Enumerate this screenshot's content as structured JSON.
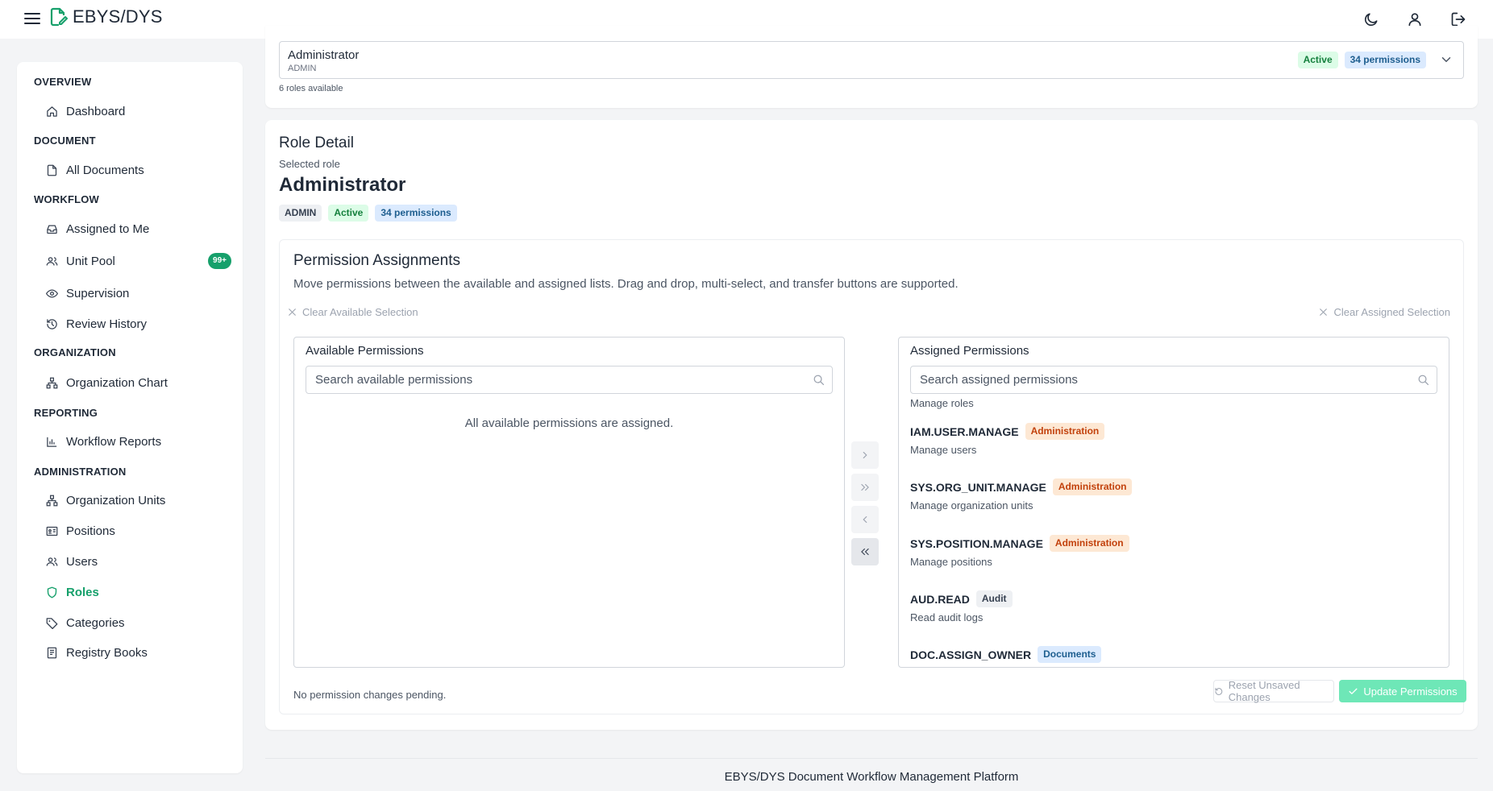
{
  "app": {
    "title": "EBYS/DYS"
  },
  "sidebar": {
    "sections": [
      {
        "label": "OVERVIEW"
      },
      {
        "label": "DOCUMENT"
      },
      {
        "label": "WORKFLOW"
      },
      {
        "label": "ORGANIZATION"
      },
      {
        "label": "REPORTING"
      },
      {
        "label": "ADMINISTRATION"
      }
    ],
    "items": [
      {
        "label": "Dashboard",
        "icon": "home-icon"
      },
      {
        "label": "All Documents",
        "icon": "document-icon"
      },
      {
        "label": "Assigned to Me",
        "icon": "inbox-icon"
      },
      {
        "label": "Unit Pool",
        "icon": "users-icon",
        "badge": "99+"
      },
      {
        "label": "Supervision",
        "icon": "eye-icon"
      },
      {
        "label": "Review History",
        "icon": "history-icon"
      },
      {
        "label": "Organization Chart",
        "icon": "org-chart-icon"
      },
      {
        "label": "Workflow Reports",
        "icon": "bar-chart-icon"
      },
      {
        "label": "Organization Units",
        "icon": "org-chart-icon"
      },
      {
        "label": "Positions",
        "icon": "id-card-icon"
      },
      {
        "label": "Users",
        "icon": "users-icon"
      },
      {
        "label": "Roles",
        "icon": "shield-icon",
        "active": true
      },
      {
        "label": "Categories",
        "icon": "tag-icon"
      },
      {
        "label": "Registry Books",
        "icon": "book-icon"
      }
    ]
  },
  "role_select": {
    "name": "Administrator",
    "code": "ADMIN",
    "status": "Active",
    "permissions_badge": "34 permissions",
    "available_note": "6 roles available"
  },
  "role_detail": {
    "title": "Role Detail",
    "subtitle": "Selected role",
    "name": "Administrator",
    "code_badge": "ADMIN",
    "status_badge": "Active",
    "permissions_badge": "34 permissions"
  },
  "permissions": {
    "title": "Permission Assignments",
    "description": "Move permissions between the available and assigned lists. Drag and drop, multi-select, and transfer buttons are supported.",
    "clear_available": "Clear Available Selection",
    "clear_assigned": "Clear Assigned Selection",
    "available": {
      "label": "Available Permissions",
      "placeholder": "Search available permissions",
      "empty_message": "All available permissions are assigned."
    },
    "assigned": {
      "label": "Assigned Permissions",
      "placeholder": "Search assigned permissions",
      "partial_top_text": "Manage roles",
      "items": [
        {
          "code": "IAM.USER.MANAGE",
          "category": "Administration",
          "description": "Manage users"
        },
        {
          "code": "SYS.ORG_UNIT.MANAGE",
          "category": "Administration",
          "description": "Manage organization units"
        },
        {
          "code": "SYS.POSITION.MANAGE",
          "category": "Administration",
          "description": "Manage positions"
        },
        {
          "code": "AUD.READ",
          "category": "Audit",
          "description": "Read audit logs"
        },
        {
          "code": "DOC.ASSIGN_OWNER",
          "category": "Documents",
          "description": ""
        }
      ]
    },
    "pending_text": "No permission changes pending.",
    "reset_label": "Reset Unsaved Changes",
    "update_label": "Update Permissions"
  },
  "footer": {
    "text": "EBYS/DYS Document Workflow Management Platform"
  },
  "colors": {
    "accent": "#16a06b",
    "administration": "#c2410c",
    "documents": "#1e5e8f"
  }
}
